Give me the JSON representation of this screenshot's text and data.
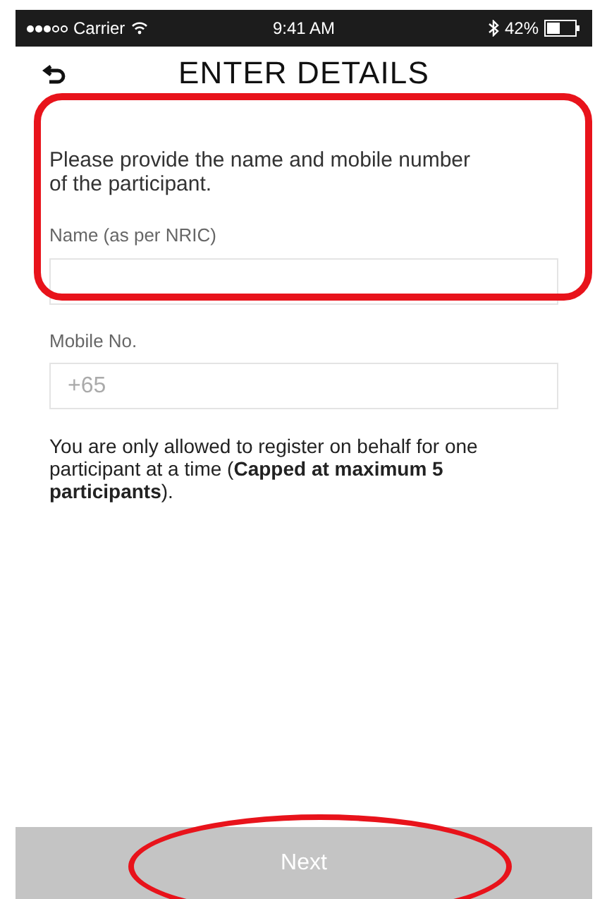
{
  "status_bar": {
    "carrier": "Carrier",
    "time": "9:41 AM",
    "battery": "42%"
  },
  "header": {
    "title": "ENTER DETAILS"
  },
  "intro": "Please provide the name and mobile number of the participant.",
  "fields": [
    {
      "label": "Name (as per NRIC)"
    },
    {
      "label": "Mobile No.",
      "placeholder": "+65"
    }
  ],
  "note": "You are only allowed to register on behalf for one participant at a time (**Capped at maximum 5 participants**).",
  "next_button": {
    "label": "Next",
    "disabled": true
  },
  "annotations": [
    {
      "kind": "rounded-rect",
      "color": "#e8131b"
    },
    {
      "kind": "ellipse",
      "color": "#e8131b"
    }
  ]
}
